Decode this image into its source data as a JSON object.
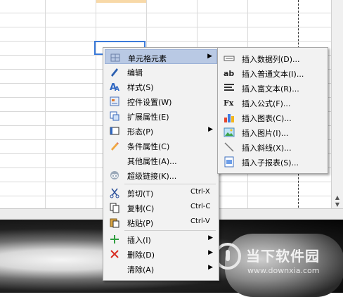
{
  "context_menu": {
    "items": [
      {
        "label": "单元格元素",
        "icon": "cell-element-icon",
        "submenu": true
      },
      {
        "label": "编辑",
        "icon": "pen-icon"
      },
      {
        "label": "样式(S)",
        "icon": "style-a-icon"
      },
      {
        "label": "控件设置(W)",
        "icon": "widget-settings-icon"
      },
      {
        "label": "扩展属性(E)",
        "icon": "extend-icon"
      },
      {
        "label": "形态(P)",
        "icon": "shape-icon",
        "submenu": true
      },
      {
        "label": "条件属性(C)",
        "icon": "pencil-icon"
      },
      {
        "label": "其他属性(A)...",
        "icon": ""
      },
      {
        "label": "超级链接(K)...",
        "icon": "hyperlink-icon"
      },
      {
        "label": "剪切(T)",
        "shortcut": "Ctrl-X",
        "icon": "scissors-icon"
      },
      {
        "label": "复制(C)",
        "shortcut": "Ctrl-C",
        "icon": "copy-icon"
      },
      {
        "label": "粘贴(P)",
        "shortcut": "Ctrl-V",
        "icon": "paste-icon"
      },
      {
        "label": "插入(I)",
        "icon": "plus-icon",
        "submenu": true
      },
      {
        "label": "删除(D)",
        "icon": "delete-x-icon",
        "submenu": true
      },
      {
        "label": "清除(A)",
        "icon": "",
        "submenu": true
      }
    ]
  },
  "submenu": {
    "items": [
      {
        "label": "插入数据列(D)...",
        "icon": "data-column-icon"
      },
      {
        "label": "插入普通文本(I)...",
        "icon": "ab-text-icon"
      },
      {
        "label": "插入富文本(R)...",
        "icon": "rich-text-icon"
      },
      {
        "label": "插入公式(F)...",
        "icon": "formula-icon"
      },
      {
        "label": "插入图表(C)...",
        "icon": "chart-icon"
      },
      {
        "label": "插入图片(I)...",
        "icon": "picture-icon"
      },
      {
        "label": "插入斜线(X)...",
        "icon": "slash-icon"
      },
      {
        "label": "插入子报表(S)...",
        "icon": "subreport-icon"
      }
    ]
  },
  "watermark": {
    "brand": "当下软件园",
    "url": "www.downxia.com"
  },
  "colors": {
    "highlight": "#b9c9e4",
    "active_cell_border": "#3b7ad9",
    "menu_bg": "#f2f2f2"
  }
}
